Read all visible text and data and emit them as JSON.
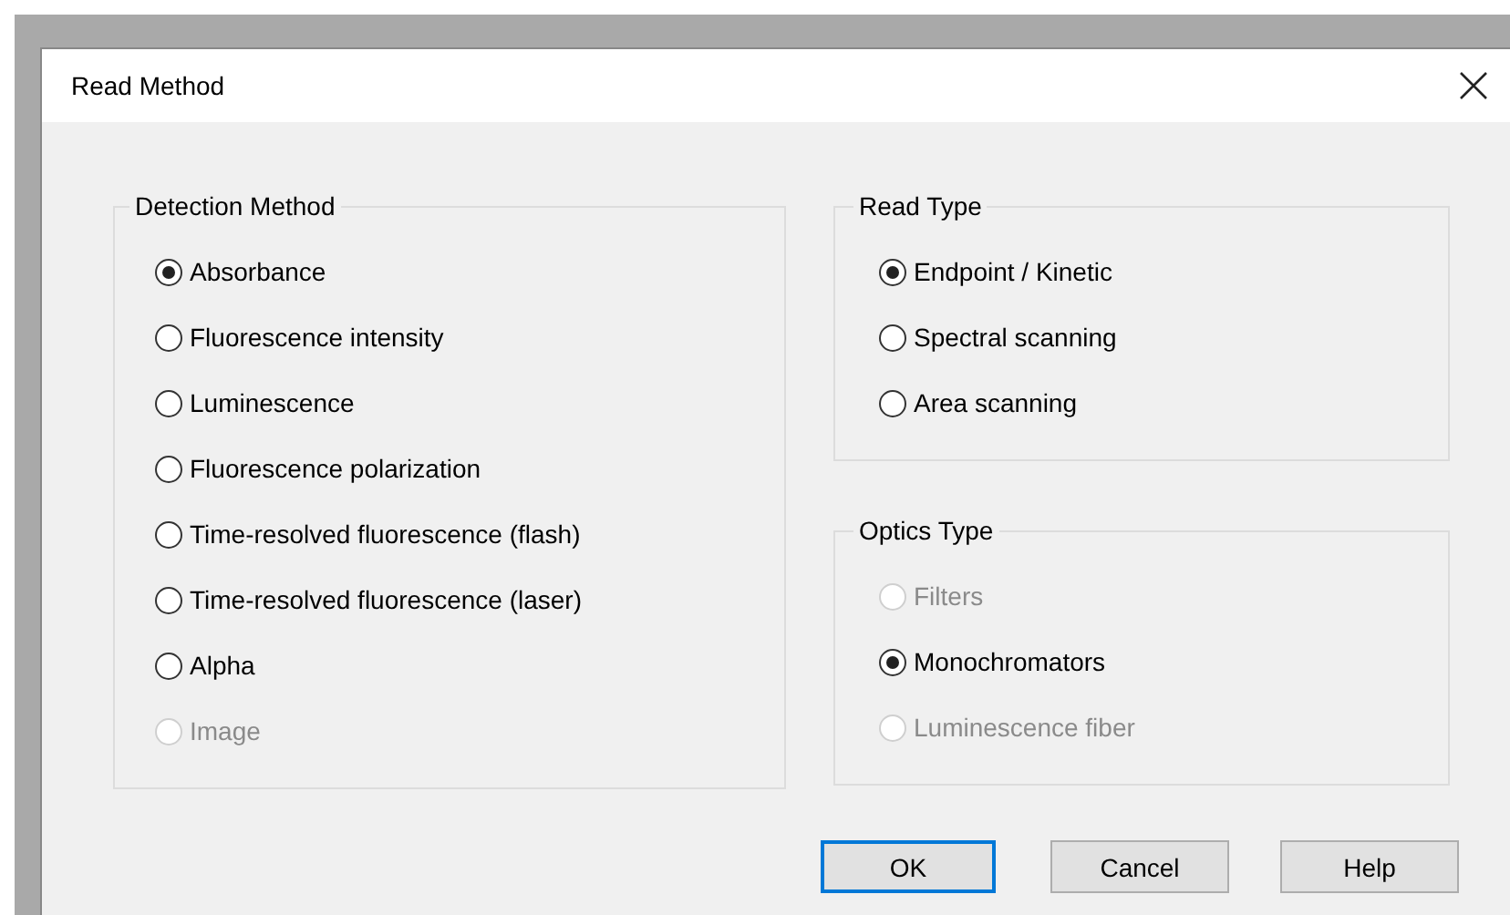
{
  "window": {
    "title": "Read Method"
  },
  "groups": [
    {
      "title": "Detection Method",
      "options": [
        {
          "label": "Absorbance",
          "selected": true,
          "disabled": false
        },
        {
          "label": "Fluorescence intensity",
          "selected": false,
          "disabled": false
        },
        {
          "label": "Luminescence",
          "selected": false,
          "disabled": false
        },
        {
          "label": "Fluorescence polarization",
          "selected": false,
          "disabled": false
        },
        {
          "label": "Time-resolved fluorescence (flash)",
          "selected": false,
          "disabled": false
        },
        {
          "label": "Time-resolved fluorescence (laser)",
          "selected": false,
          "disabled": false
        },
        {
          "label": "Alpha",
          "selected": false,
          "disabled": false
        },
        {
          "label": "Image",
          "selected": false,
          "disabled": true
        }
      ]
    },
    {
      "title": "Read Type",
      "options": [
        {
          "label": "Endpoint / Kinetic",
          "selected": true,
          "disabled": false
        },
        {
          "label": "Spectral scanning",
          "selected": false,
          "disabled": false
        },
        {
          "label": "Area scanning",
          "selected": false,
          "disabled": false
        }
      ]
    },
    {
      "title": "Optics Type",
      "options": [
        {
          "label": "Filters",
          "selected": false,
          "disabled": true
        },
        {
          "label": "Monochromators",
          "selected": true,
          "disabled": false
        },
        {
          "label": "Luminescence fiber",
          "selected": false,
          "disabled": true
        }
      ]
    }
  ],
  "buttons": [
    {
      "label": "OK",
      "default": true
    },
    {
      "label": "Cancel",
      "default": false
    },
    {
      "label": "Help",
      "default": false
    }
  ]
}
